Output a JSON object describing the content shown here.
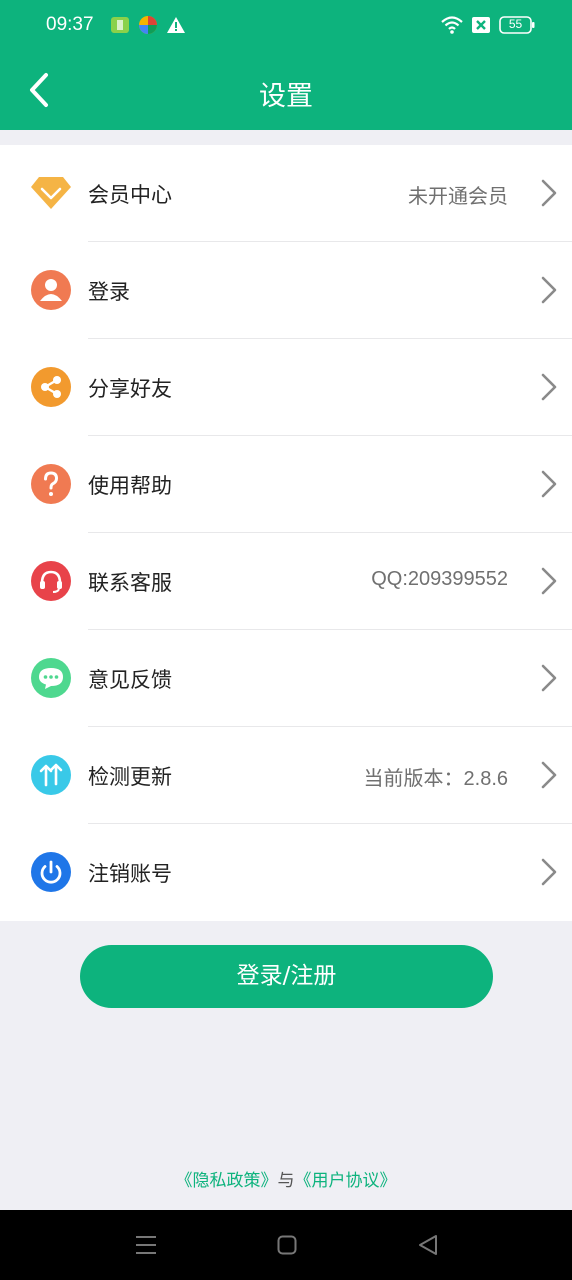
{
  "status_bar": {
    "time": "09:37",
    "battery": "55",
    "icons": [
      "notification-app-icon",
      "colorful-app-icon",
      "warning-icon",
      "wifi-icon",
      "no-sim-icon",
      "battery-icon"
    ]
  },
  "header": {
    "title": "设置",
    "back_icon": "chevron-left-icon"
  },
  "menu": {
    "items": [
      {
        "label": "会员中心",
        "value": "未开通会员",
        "icon": "diamond-icon",
        "color": "#f5b445"
      },
      {
        "label": "登录",
        "value": "",
        "icon": "user-icon",
        "color": "#f07a52"
      },
      {
        "label": "分享好友",
        "value": "",
        "icon": "share-icon",
        "color": "#f29a2e"
      },
      {
        "label": "使用帮助",
        "value": "",
        "icon": "help-icon",
        "color": "#f07a52"
      },
      {
        "label": "联系客服",
        "value": "QQ:209399552",
        "icon": "headset-icon",
        "color": "#e8434a"
      },
      {
        "label": "意见反馈",
        "value": "",
        "icon": "chat-bubble-icon",
        "color": "#4ed88f"
      },
      {
        "label": "检测更新",
        "value": "当前版本：2.8.6",
        "icon": "update-arrows-icon",
        "color": "#39c9e8"
      },
      {
        "label": "注销账号",
        "value": "",
        "icon": "power-icon",
        "color": "#1f76e8"
      }
    ]
  },
  "login_button": {
    "label": "登录/注册"
  },
  "footer": {
    "privacy": "《隐私政策》",
    "and": "与",
    "agreement": "《用户协议》"
  },
  "colors": {
    "accent": "#0db37d",
    "background": "#efeff4"
  }
}
